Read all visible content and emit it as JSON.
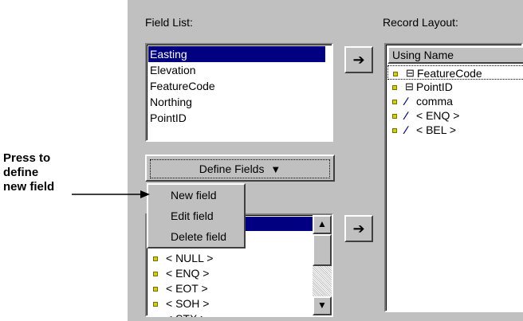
{
  "field_list": {
    "title": "Field List:",
    "items": [
      "Easting",
      "Elevation",
      "FeatureCode",
      "Northing",
      "PointID"
    ],
    "selected": "Easting"
  },
  "record_layout": {
    "title": "Record Layout:",
    "header": "Using Name",
    "rows": [
      {
        "icon": "table-icon",
        "text": "FeatureCode"
      },
      {
        "icon": "table-icon",
        "text": "PointID"
      },
      {
        "icon": "slash-icon",
        "text": "comma"
      },
      {
        "icon": "slash-icon",
        "text": "< ENQ  >"
      },
      {
        "icon": "slash-icon",
        "text": "< BEL  >"
      }
    ]
  },
  "define_fields": {
    "label": "Define Fields",
    "accelerator": "F",
    "arrow": "▼"
  },
  "menu": {
    "items": [
      "New field",
      "Edit field",
      "Delete field"
    ]
  },
  "lower_list": {
    "items": [
      "< NULL  >",
      "< ENQ  >",
      "< EOT  >",
      "< SOH  >",
      "< STX  >"
    ]
  },
  "callout": {
    "lines": [
      "Press to",
      "define",
      "new field"
    ]
  },
  "add_arrow_glyph": "➔"
}
